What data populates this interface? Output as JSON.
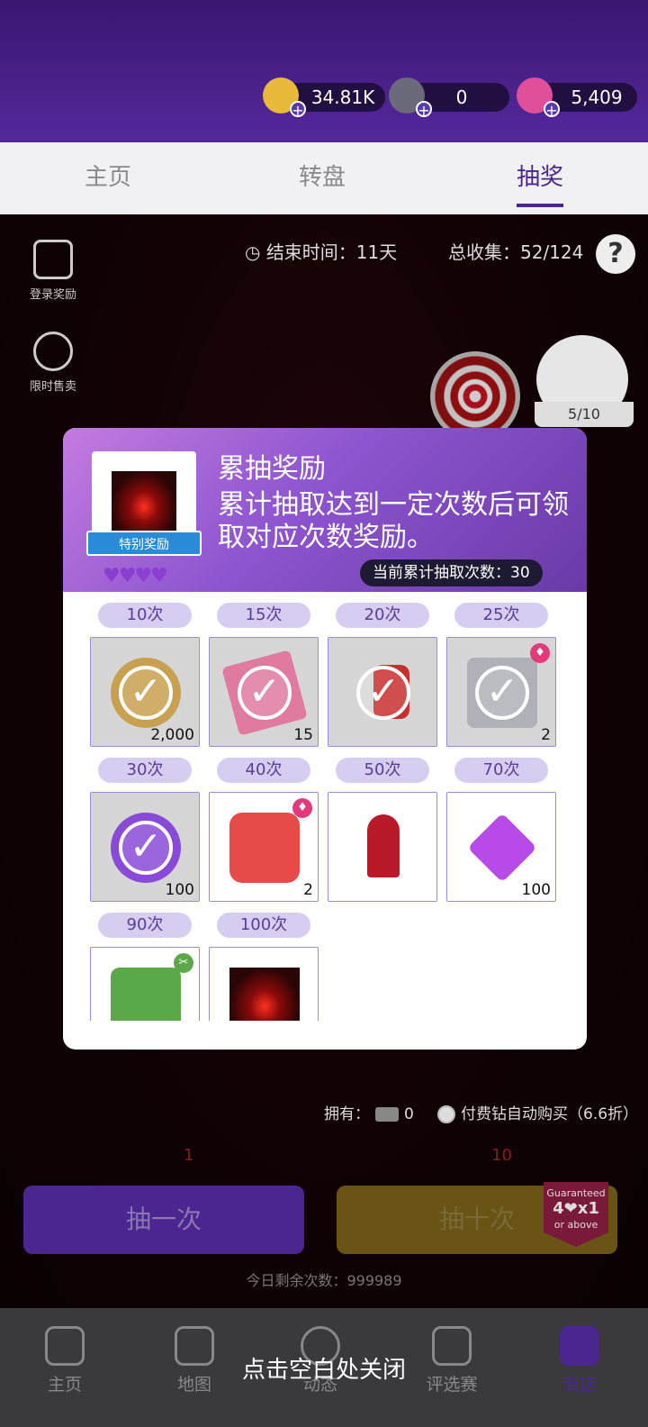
{
  "currencies": [
    {
      "name": "gold-coin",
      "value": "34.81K",
      "color": "#e8b93a"
    },
    {
      "name": "diamond",
      "value": "0",
      "color": "#6a6a7a"
    },
    {
      "name": "pink-gem",
      "value": "5,409",
      "color": "#e0509a"
    }
  ],
  "tabs": [
    {
      "label": "主页",
      "active": false
    },
    {
      "label": "转盘",
      "active": false
    },
    {
      "label": "抽奖",
      "active": true
    }
  ],
  "event": {
    "end_time": "结束时间：11天",
    "collect": "总收集：52/124",
    "help_icon": "question-icon"
  },
  "side_buttons": [
    {
      "label": "登录奖励",
      "icon": "calendar-check-icon"
    },
    {
      "label": "限时售卖",
      "icon": "stopwatch-icon"
    }
  ],
  "avatar_progress": "5/10",
  "own": {
    "label": "拥有：",
    "count": "0"
  },
  "auto_buy": "付费钻自动购买（6.6折）",
  "cost_one": "1",
  "cost_ten": "10",
  "draw_one_label": "抽一次",
  "draw_ten_label": "抽十次",
  "guarantee": {
    "top": "Guaranteed",
    "mid": "4❤x1",
    "bottom": "or above"
  },
  "remaining": "今日剩余次数：999989",
  "bottom_nav": [
    {
      "label": "主页",
      "icon": "home-icon",
      "active": false
    },
    {
      "label": "地图",
      "icon": "map-icon",
      "active": false
    },
    {
      "label": "动态",
      "icon": "feed-icon",
      "active": false
    },
    {
      "label": "评选赛",
      "icon": "trophy-icon",
      "active": false
    },
    {
      "label": "商店",
      "icon": "cart-icon",
      "active": true
    }
  ],
  "close_hint": "点击空白处关闭",
  "modal": {
    "title": "累抽奖励",
    "desc": "累计抽取达到一定次数后可领取对应次数奖励。",
    "feature_ribbon": "特别奖励",
    "hearts": "♥♥♥♥",
    "count_label": "当前累计抽取次数：30",
    "rewards": [
      {
        "label": "10次",
        "qty": "2,000",
        "claimed": true,
        "item": "gold-coin",
        "color": "#c8a050"
      },
      {
        "label": "15次",
        "qty": "15",
        "claimed": true,
        "item": "pink-ticket",
        "color": "#e07aa0"
      },
      {
        "label": "20次",
        "qty": "",
        "claimed": true,
        "item": "rose-accessory",
        "color": "#c83030"
      },
      {
        "label": "25次",
        "qty": "2",
        "claimed": true,
        "item": "perfume-bottle",
        "color": "#b0b0b8"
      },
      {
        "label": "30次",
        "qty": "100",
        "claimed": true,
        "item": "diamond",
        "color": "#8a4ad8"
      },
      {
        "label": "40次",
        "qty": "2",
        "claimed": false,
        "item": "perfume-bottle",
        "color": "#e84a4a"
      },
      {
        "label": "50次",
        "qty": "",
        "claimed": false,
        "item": "cocktail",
        "color": "#b81a2a"
      },
      {
        "label": "70次",
        "qty": "100",
        "claimed": false,
        "item": "diamond",
        "color": "#b84ae8"
      },
      {
        "label": "90次",
        "qty": "",
        "claimed": false,
        "item": "makeup-pouch",
        "color": "#5aa848"
      },
      {
        "label": "100次",
        "qty": "",
        "claimed": false,
        "item": "red-corridor",
        "color": "#8a0a0a"
      }
    ]
  }
}
